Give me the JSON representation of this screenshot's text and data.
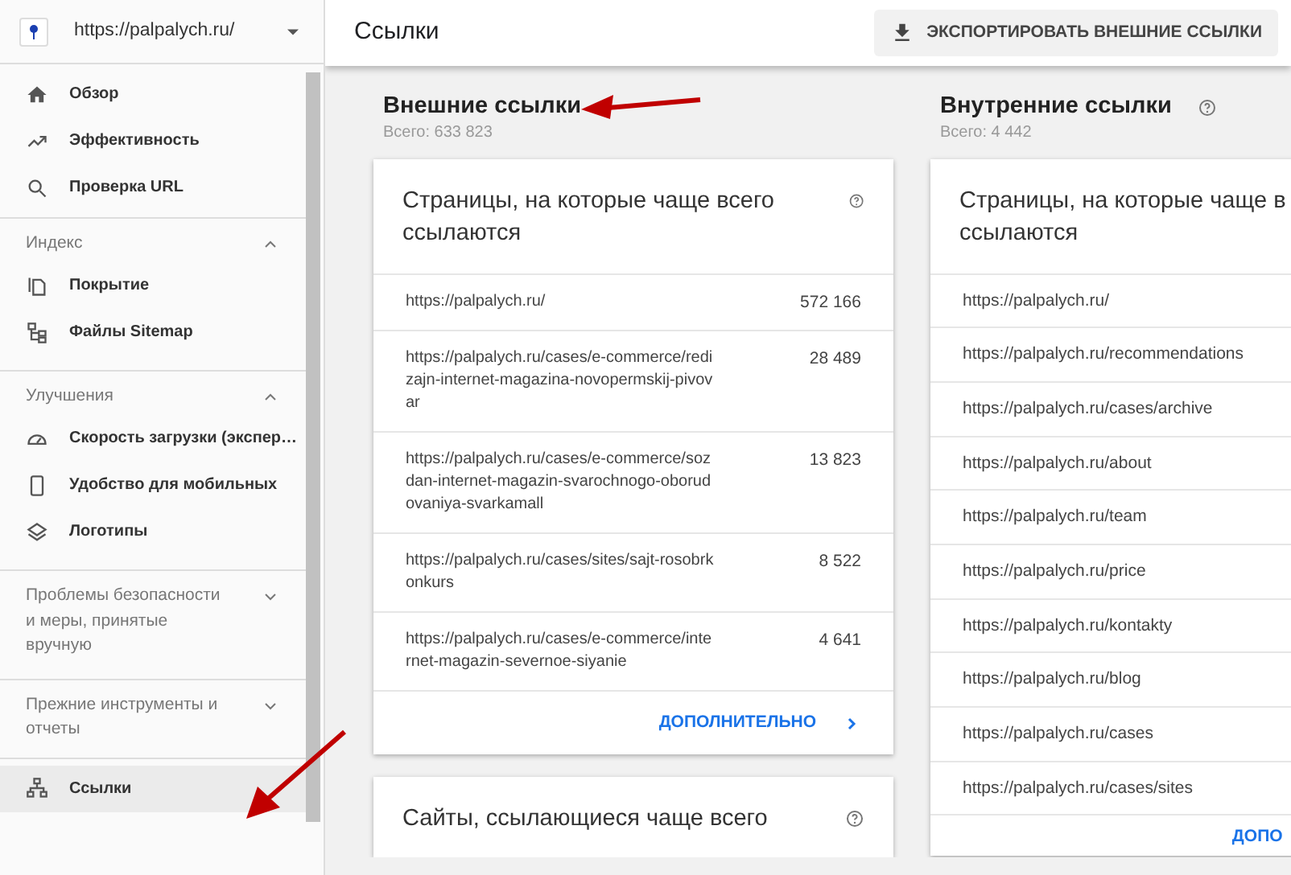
{
  "site": {
    "url": "https://palpalych.ru/"
  },
  "nav": [
    {
      "kind": "item",
      "label": "Обзор",
      "selected": false
    },
    {
      "kind": "item",
      "label": "Эффективность",
      "selected": false
    },
    {
      "kind": "item",
      "label": "Проверка URL",
      "selected": false
    },
    {
      "kind": "section",
      "label": "Индекс",
      "expanded": true,
      "items": [
        {
          "label": "Покрытие",
          "selected": false
        },
        {
          "label": "Файлы Sitemap",
          "selected": false
        }
      ]
    },
    {
      "kind": "section",
      "label": "Улучшения",
      "expanded": true,
      "items": [
        {
          "label": "Скорость загрузки (экспер…",
          "selected": false
        },
        {
          "label": "Удобство для мобильных",
          "selected": false
        },
        {
          "label": "Логотипы",
          "selected": false
        }
      ]
    },
    {
      "kind": "section",
      "label": "Проблемы безопасности и меры, принятые вручную",
      "expanded": false
    },
    {
      "kind": "section",
      "label": "Прежние инструменты и отчеты",
      "expanded": false
    },
    {
      "kind": "item",
      "label": "Ссылки",
      "selected": true
    }
  ],
  "header": {
    "title": "Ссылки",
    "export_button": "ЭКСПОРТИРОВАТЬ ВНЕШНИЕ ССЫЛКИ"
  },
  "columns": [
    {
      "title": "Внешние ссылки",
      "help": false,
      "total": "Всего: 633 823",
      "cards": [
        {
          "title_lines": [
            "Страницы, на которые чаще всего ссылаются"
          ],
          "help": true,
          "rows": [
            {
              "url": "https://palpalych.ru/",
              "count": "572 166"
            },
            {
              "url": "https://palpalych.ru/cases/e-commerce/redizajn-internet-magazina-novopermskij-pivovar",
              "count": "28 489"
            },
            {
              "url": "https://palpalych.ru/cases/e-commerce/sozdan-internet-magazin-svarochnogo-oborudovaniya-svarkamall",
              "count": "13 823"
            },
            {
              "url": "https://palpalych.ru/cases/sites/sajt-rosobrkonkurs",
              "count": "8 522"
            },
            {
              "url": "https://palpalych.ru/cases/e-commerce/internet-magazin-severnoe-siyanie",
              "count": "4 641"
            }
          ],
          "more": "ДОПОЛНИТЕЛЬНО"
        },
        {
          "title_lines": [
            "Сайты, ссылающиеся чаще всего"
          ],
          "help": true
        }
      ]
    },
    {
      "title": "Внутренние ссылки",
      "help": true,
      "total": "Всего: 4 442",
      "cards": [
        {
          "title_lines": [
            "Страницы, на которые чаще в",
            "ссылаются"
          ],
          "help": false,
          "rows": [
            {
              "url": "https://palpalych.ru/"
            },
            {
              "url": "https://palpalych.ru/recommendations"
            },
            {
              "url": "https://palpalych.ru/cases/archive"
            },
            {
              "url": "https://palpalych.ru/about"
            },
            {
              "url": "https://palpalych.ru/team"
            },
            {
              "url": "https://palpalych.ru/price"
            },
            {
              "url": "https://palpalych.ru/kontakty"
            },
            {
              "url": "https://palpalych.ru/blog"
            },
            {
              "url": "https://palpalych.ru/cases"
            },
            {
              "url": "https://palpalych.ru/cases/sites"
            }
          ],
          "more": "ДОПО"
        }
      ]
    }
  ]
}
